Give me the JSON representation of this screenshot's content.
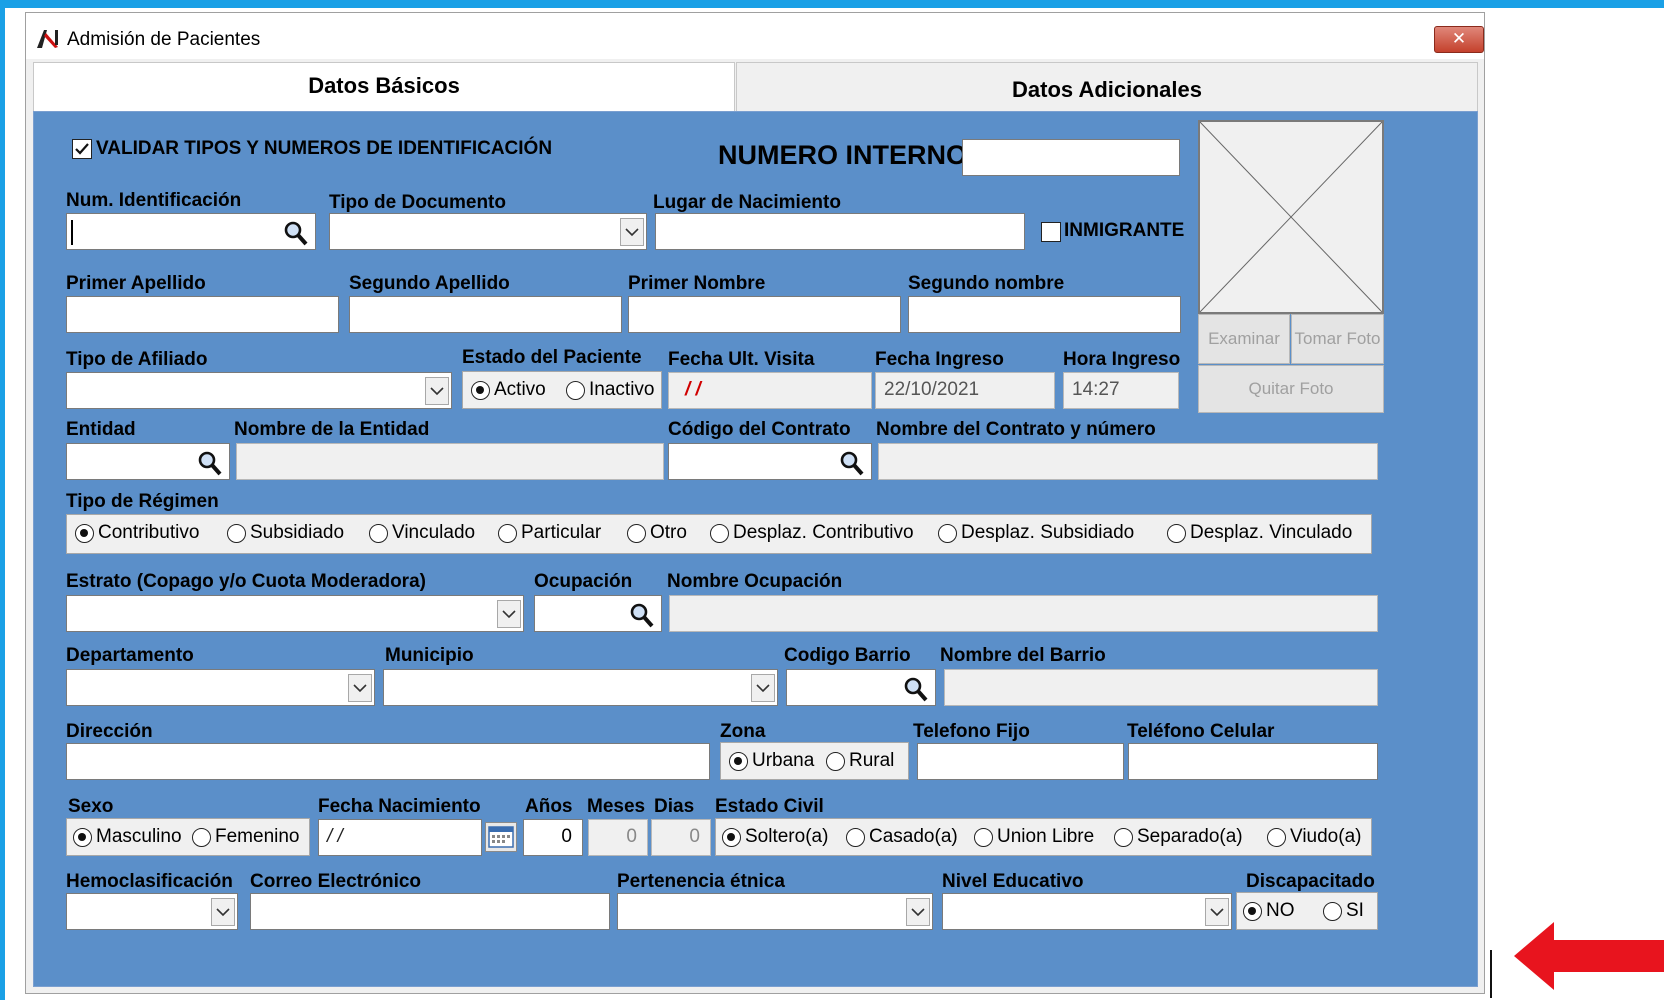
{
  "window": {
    "title": "Admisión de Pacientes",
    "close_label": "✕"
  },
  "tabs": [
    {
      "label": "Datos Básicos"
    },
    {
      "label": "Datos Adicionales"
    }
  ],
  "form": {
    "validar_label": "VALIDAR TIPOS Y NUMEROS DE IDENTIFICACIÓN",
    "validar_checked": true,
    "numero_interno_label": "NUMERO INTERNO",
    "numero_interno_value": "",
    "num_identificacion_label": "Num. Identificación",
    "tipo_documento_label": "Tipo de Documento",
    "lugar_nacimiento_label": "Lugar de Nacimiento",
    "inmigrante_label": "INMIGRANTE",
    "primer_apellido_label": "Primer Apellido",
    "segundo_apellido_label": "Segundo Apellido",
    "primer_nombre_label": "Primer Nombre",
    "segundo_nombre_label": "Segundo nombre",
    "tipo_afiliado_label": "Tipo de Afiliado",
    "estado_paciente_label": "Estado del Paciente",
    "estado_options": [
      "Activo",
      "Inactivo"
    ],
    "fecha_ult_visita_label": "Fecha Ult. Visita",
    "fecha_ult_visita_value": "/ /",
    "fecha_ingreso_label": "Fecha Ingreso",
    "fecha_ingreso_value": "22/10/2021",
    "hora_ingreso_label": "Hora Ingreso",
    "hora_ingreso_value": "14:27",
    "entidad_label": "Entidad",
    "nombre_entidad_label": "Nombre de la Entidad",
    "codigo_contrato_label": "Código del Contrato",
    "nombre_contrato_label": "Nombre del Contrato y número",
    "tipo_regimen_label": "Tipo de Régimen",
    "regimen_options": [
      "Contributivo",
      "Subsidiado",
      "Vinculado",
      "Particular",
      "Otro",
      "Desplaz. Contributivo",
      "Desplaz. Subsidiado",
      "Desplaz. Vinculado"
    ],
    "estrato_label": "Estrato (Copago y/o Cuota Moderadora)",
    "ocupacion_label": "Ocupación",
    "nombre_ocupacion_label": "Nombre Ocupación",
    "departamento_label": "Departamento",
    "municipio_label": "Municipio",
    "codigo_barrio_label": "Codigo Barrio",
    "nombre_barrio_label": "Nombre del Barrio",
    "direccion_label": "Dirección",
    "zona_label": "Zona",
    "zona_options": [
      "Urbana",
      "Rural"
    ],
    "telefono_fijo_label": "Telefono Fijo",
    "telefono_celular_label": "Teléfono Celular",
    "sexo_label": "Sexo",
    "sexo_options": [
      "Masculino",
      "Femenino"
    ],
    "fecha_nacimiento_label": "Fecha Nacimiento",
    "fecha_nacimiento_value": "/ /",
    "anos_label": "Años",
    "anos_value": "0",
    "meses_label": "Meses",
    "meses_value": "0",
    "dias_label": "Dias",
    "dias_value": "0",
    "estado_civil_label": "Estado Civil",
    "estado_civil_options": [
      "Soltero(a)",
      "Casado(a)",
      "Union Libre",
      "Separado(a)",
      "Viudo(a)"
    ],
    "hemoclasificacion_label": "Hemoclasificación",
    "correo_label": "Correo Electrónico",
    "pertenencia_label": "Pertenencia étnica",
    "nivel_educativo_label": "Nivel Educativo",
    "discapacitado_label": "Discapacitado",
    "discapacitado_options": [
      "NO",
      "SI"
    ]
  },
  "photo": {
    "examinar_label": "Examinar",
    "tomar_foto_label": "Tomar Foto",
    "quitar_foto_label": "Quitar Foto"
  },
  "colors": {
    "panel": "#5b8fc9",
    "frame": "#1aa0e6",
    "arrow": "#e8141e"
  }
}
